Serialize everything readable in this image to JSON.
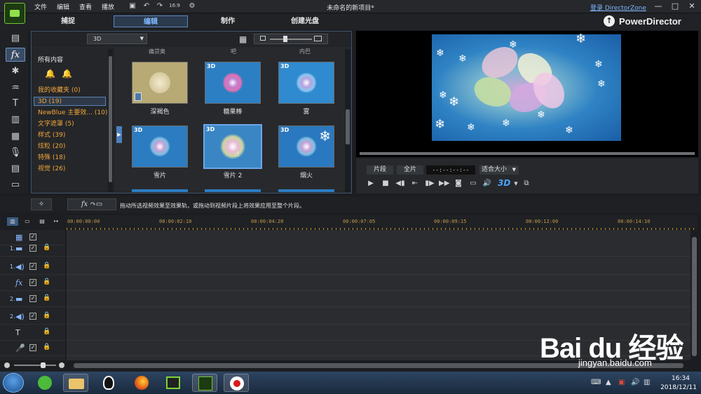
{
  "menubar": {
    "items": [
      "文件",
      "编辑",
      "查看",
      "播放"
    ],
    "project_title": "未命名的新项目*",
    "login": "登录 DirectorZone",
    "win_min": "—",
    "win_max": "□",
    "win_close": "✕",
    "res_label": "16:9"
  },
  "modes": {
    "capture": "捕捉",
    "edit": "编辑",
    "produce": "制作",
    "disc": "创建光盘"
  },
  "brand": "PowerDirector",
  "library": {
    "category": "3D",
    "tree_header": "所有内容",
    "tree_items": [
      {
        "label": "我的收藏夹",
        "count": "(0)"
      },
      {
        "label": "3D",
        "count": "(19)"
      },
      {
        "label": "NewBlue 主要效...",
        "count": "(10)"
      },
      {
        "label": "文字遮罩",
        "count": "(5)"
      },
      {
        "label": "样式",
        "count": "(39)"
      },
      {
        "label": "炫粒",
        "count": "(20)"
      },
      {
        "label": "特殊",
        "count": "(18)"
      },
      {
        "label": "视觉",
        "count": "(26)"
      }
    ],
    "cut_labels": [
      "痛贷奥",
      "吧",
      "内巴"
    ],
    "thumbs": [
      {
        "label": "深褐色",
        "badge": "",
        "tone": "#b7aa74"
      },
      {
        "label": "糖果棒",
        "badge": "3D",
        "tone": "#2d7fc4"
      },
      {
        "label": "雾",
        "badge": "3D",
        "tone": "#2f8ad0"
      },
      {
        "label": "雪片",
        "badge": "3D",
        "tone": "#2c7cc2"
      },
      {
        "label": "雪片 2",
        "badge": "3D",
        "tone": "#3a86c4"
      },
      {
        "label": "烟火",
        "badge": "3D",
        "tone": "#2a78bf"
      }
    ]
  },
  "preview": {
    "clip_btn": "片段",
    "movie_btn": "全片",
    "timecode": "--:--:--:--",
    "fit": "适合大小",
    "btn_3d": "3D"
  },
  "hint": {
    "text": "拖动所选视频效果至效果轨，或拖动到视频片段上将效果应用至整个片段。",
    "fx_label": "fx"
  },
  "timeline": {
    "ticks": [
      "00:00:00:00",
      "00:00:02:10",
      "00:00:04:20",
      "00:00:07:05",
      "00:00:09:15",
      "00:00:12:00",
      "00:00:14:10"
    ],
    "tracks": [
      {
        "idx": "",
        "icon": "▦",
        "chk": "✓",
        "lock": ""
      },
      {
        "idx": "1.",
        "icon": "▬",
        "chk": "✓",
        "lock": "🔒"
      },
      {
        "idx": "1.",
        "icon": "◀)",
        "chk": "✓",
        "lock": "🔒"
      },
      {
        "idx": "",
        "icon": "fx",
        "chk": "✓",
        "lock": "🔒"
      },
      {
        "idx": "2.",
        "icon": "▬",
        "chk": "✓",
        "lock": "🔒"
      },
      {
        "idx": "2.",
        "icon": "◀)",
        "chk": "✓",
        "lock": "🔒"
      },
      {
        "idx": "",
        "icon": "T",
        "chk": "",
        "lock": "🔒"
      },
      {
        "idx": "",
        "icon": "🎤",
        "chk": "✓",
        "lock": "🔒"
      }
    ]
  },
  "taskbar": {
    "time": "16:34",
    "date": "2018/12/11"
  },
  "watermark": {
    "main": "Bai du 经验",
    "sub": "jingyan.baidu.com"
  }
}
